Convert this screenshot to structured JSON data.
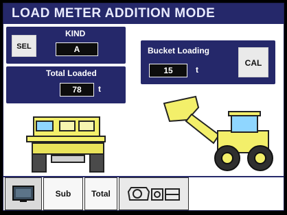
{
  "title": "LOAD METER ADDITION MODE",
  "kind_panel": {
    "sel_label": "SEL",
    "kind_label": "KIND",
    "kind_value": "A"
  },
  "total_panel": {
    "label": "Total Loaded",
    "value": "78",
    "unit": "t"
  },
  "bucket_panel": {
    "label": "Bucket Loading",
    "value": "15",
    "unit": "t",
    "cal_label": "CAL"
  },
  "bottom_tabs": {
    "sub_label": "Sub",
    "total_label": "Total"
  },
  "colors": {
    "panel": "#25286a",
    "truck_body": "#f3ef6a",
    "wheel": "#4a4a4a"
  },
  "icons": {
    "screen_tab": "monitor-icon",
    "machine_tab": "machine-diagram-icon"
  }
}
